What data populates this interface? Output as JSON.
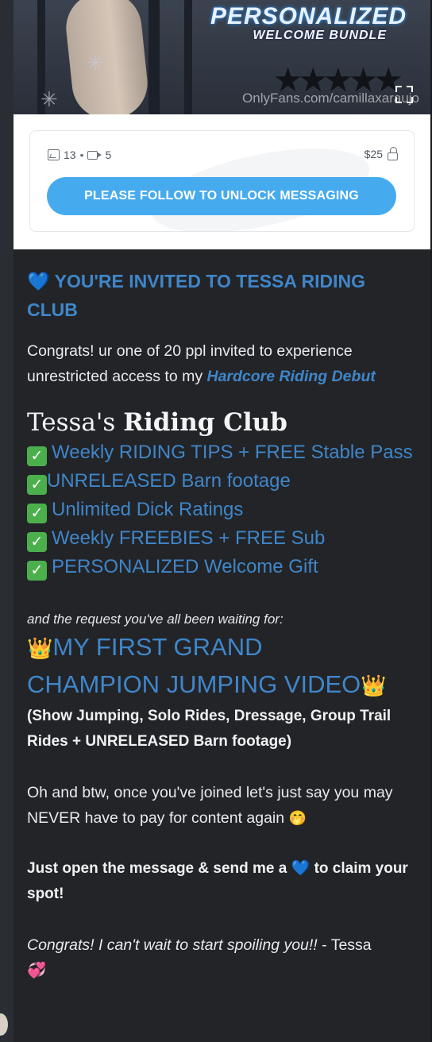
{
  "hero": {
    "title_line1": "PERSONALIZED",
    "title_line2": "WELCOME BUNDLE",
    "watermark": "OnlyFans.com/camillaxaraujo",
    "expand_icon": "expand-icon"
  },
  "locked_post": {
    "photo_count": "13",
    "separator": "•",
    "video_count": "5",
    "price": "$25",
    "button_label": "PLEASE FOLLOW TO UNLOCK MESSAGING"
  },
  "message": {
    "heading_emoji": "💙",
    "heading_text": " YOU'RE INVITED TO TESSA RIDING CLUB",
    "intro_text": "Congrats! ur one of 20 ppl invited to experience unrestricted access to my ",
    "intro_link": "Hardcore Riding Debut",
    "club_name_prefix": "Tessa's ",
    "club_name_bold": "Riding Club",
    "check_glyph": "✓",
    "benefits": [
      {
        "text": "Weekly RIDING TIPS + FREE Stable Pass",
        "space": true
      },
      {
        "text": "UNRELEASED Barn footage",
        "space": false
      },
      {
        "text": "Unlimited Dick Ratings",
        "space": true
      },
      {
        "text": "Weekly FREEBIES + FREE Sub",
        "space": true
      },
      {
        "text": "PERSONALIZED Welcome Gift",
        "space": true
      }
    ],
    "request_intro": "and the request you've all been waiting for:",
    "crown_emoji": "👑",
    "grand_line1": "MY FIRST GRAND",
    "grand_line2": "CHAMPION JUMPING VIDEO",
    "grand_details": "(Show Jumping, Solo Rides, Dressage, Group Trail Rides + UNRELEASED Barn footage)",
    "btw_text": "Oh and btw, once you've joined let's just say you may NEVER have to pay for content again ",
    "btw_emoji": "🤭",
    "cta_text_1": "Just open the message & send me a ",
    "cta_heart": "💙",
    "cta_text_2": " to claim your spot!",
    "signoff_italic": "Congrats! I can't wait to start spoiling you!!",
    "signoff_plain": " - Tessa",
    "signoff_emoji": "💞"
  },
  "colors": {
    "accent_blue": "#3f86c9",
    "button_blue": "#46abee",
    "background": "#232428",
    "check_green": "#4bb04c"
  }
}
